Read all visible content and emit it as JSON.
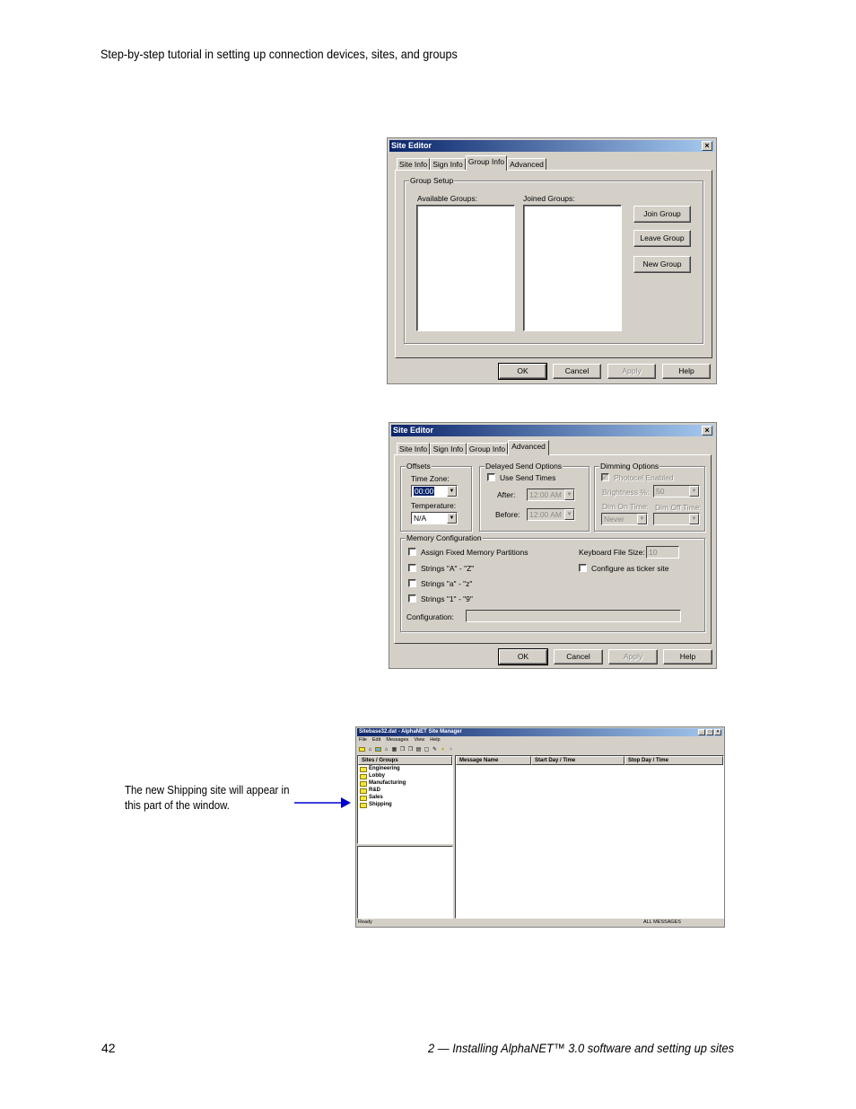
{
  "header": {
    "text": "Step-by-step tutorial in setting up connection devices, sites, and groups"
  },
  "footer": {
    "page_number": "42",
    "chapter": "2 — Installing AlphaNET™ 3.0 software and setting up sites"
  },
  "callout": {
    "text": "The new Shipping site will appear in this part of the window."
  },
  "dialog1": {
    "title": "Site Editor",
    "close": "×",
    "tabs": [
      "Site Info",
      "Sign Info",
      "Group Info",
      "Advanced"
    ],
    "group_setup": "Group Setup",
    "available_groups": "Available Groups:",
    "joined_groups": "Joined Groups:",
    "join_group": "Join Group",
    "leave_group": "Leave Group",
    "new_group": "New Group",
    "ok": "OK",
    "cancel": "Cancel",
    "apply": "Apply",
    "help": "Help"
  },
  "dialog2": {
    "title": "Site Editor",
    "close": "×",
    "tabs": [
      "Site Info",
      "Sign Info",
      "Group Info",
      "Advanced"
    ],
    "offsets": "Offsets",
    "time_zone": "Time Zone:",
    "time_zone_value": "00:00",
    "temperature": "Temperature:",
    "temperature_value": "N/A",
    "delayed": "Delayed Send Options",
    "use_send_times": "Use Send Times",
    "after": "After:",
    "after_value": "12:00 AM",
    "before": "Before:",
    "before_value": "12:00 AM",
    "dimming": "Dimming Options",
    "photocel": "Photocel Enabled",
    "brightness": "Brightness %:",
    "brightness_value": "50",
    "dim_on": "Dim On Time:",
    "dim_off": "Dim Off Time:",
    "dim_on_value": "Never",
    "memory": "Memory Configuration",
    "assign_fixed": "Assign Fixed Memory Partitions",
    "strings_upper": "Strings \"A\" - \"Z\"",
    "strings_lower": "Strings \"a\" - \"z\"",
    "strings_num": "Strings \"1\" - \"9\"",
    "keyboard_file_size": "Keyboard File Size:",
    "keyboard_value": "10",
    "configure_ticker": "Configure as ticker site",
    "configuration": "Configuration:",
    "ok": "OK",
    "cancel": "Cancel",
    "apply": "Apply",
    "help": "Help",
    "check_mark": "✓"
  },
  "manager": {
    "title": "Sitebase32.dat - AlphaNET Site Manager",
    "window_buttons": [
      "_",
      "□",
      "×"
    ],
    "menu": [
      "File",
      "Edit",
      "Messages",
      "View",
      "Help"
    ],
    "sites_header": "Sites / Groups",
    "sites": [
      "Engineering",
      "Lobby",
      "Manufacturing",
      "R&D",
      "Sales",
      "Shipping"
    ],
    "col_message": "Message Name",
    "col_start": "Start Day / Time",
    "col_stop": "Stop Day / Time",
    "status_left": "Ready",
    "status_right": "ALL MESSAGES"
  },
  "colors": {
    "titlebar_start": "#0a246a",
    "titlebar_end": "#a6caf0",
    "dialog_face": "#d4d0c8",
    "arrow": "#0000cc"
  }
}
